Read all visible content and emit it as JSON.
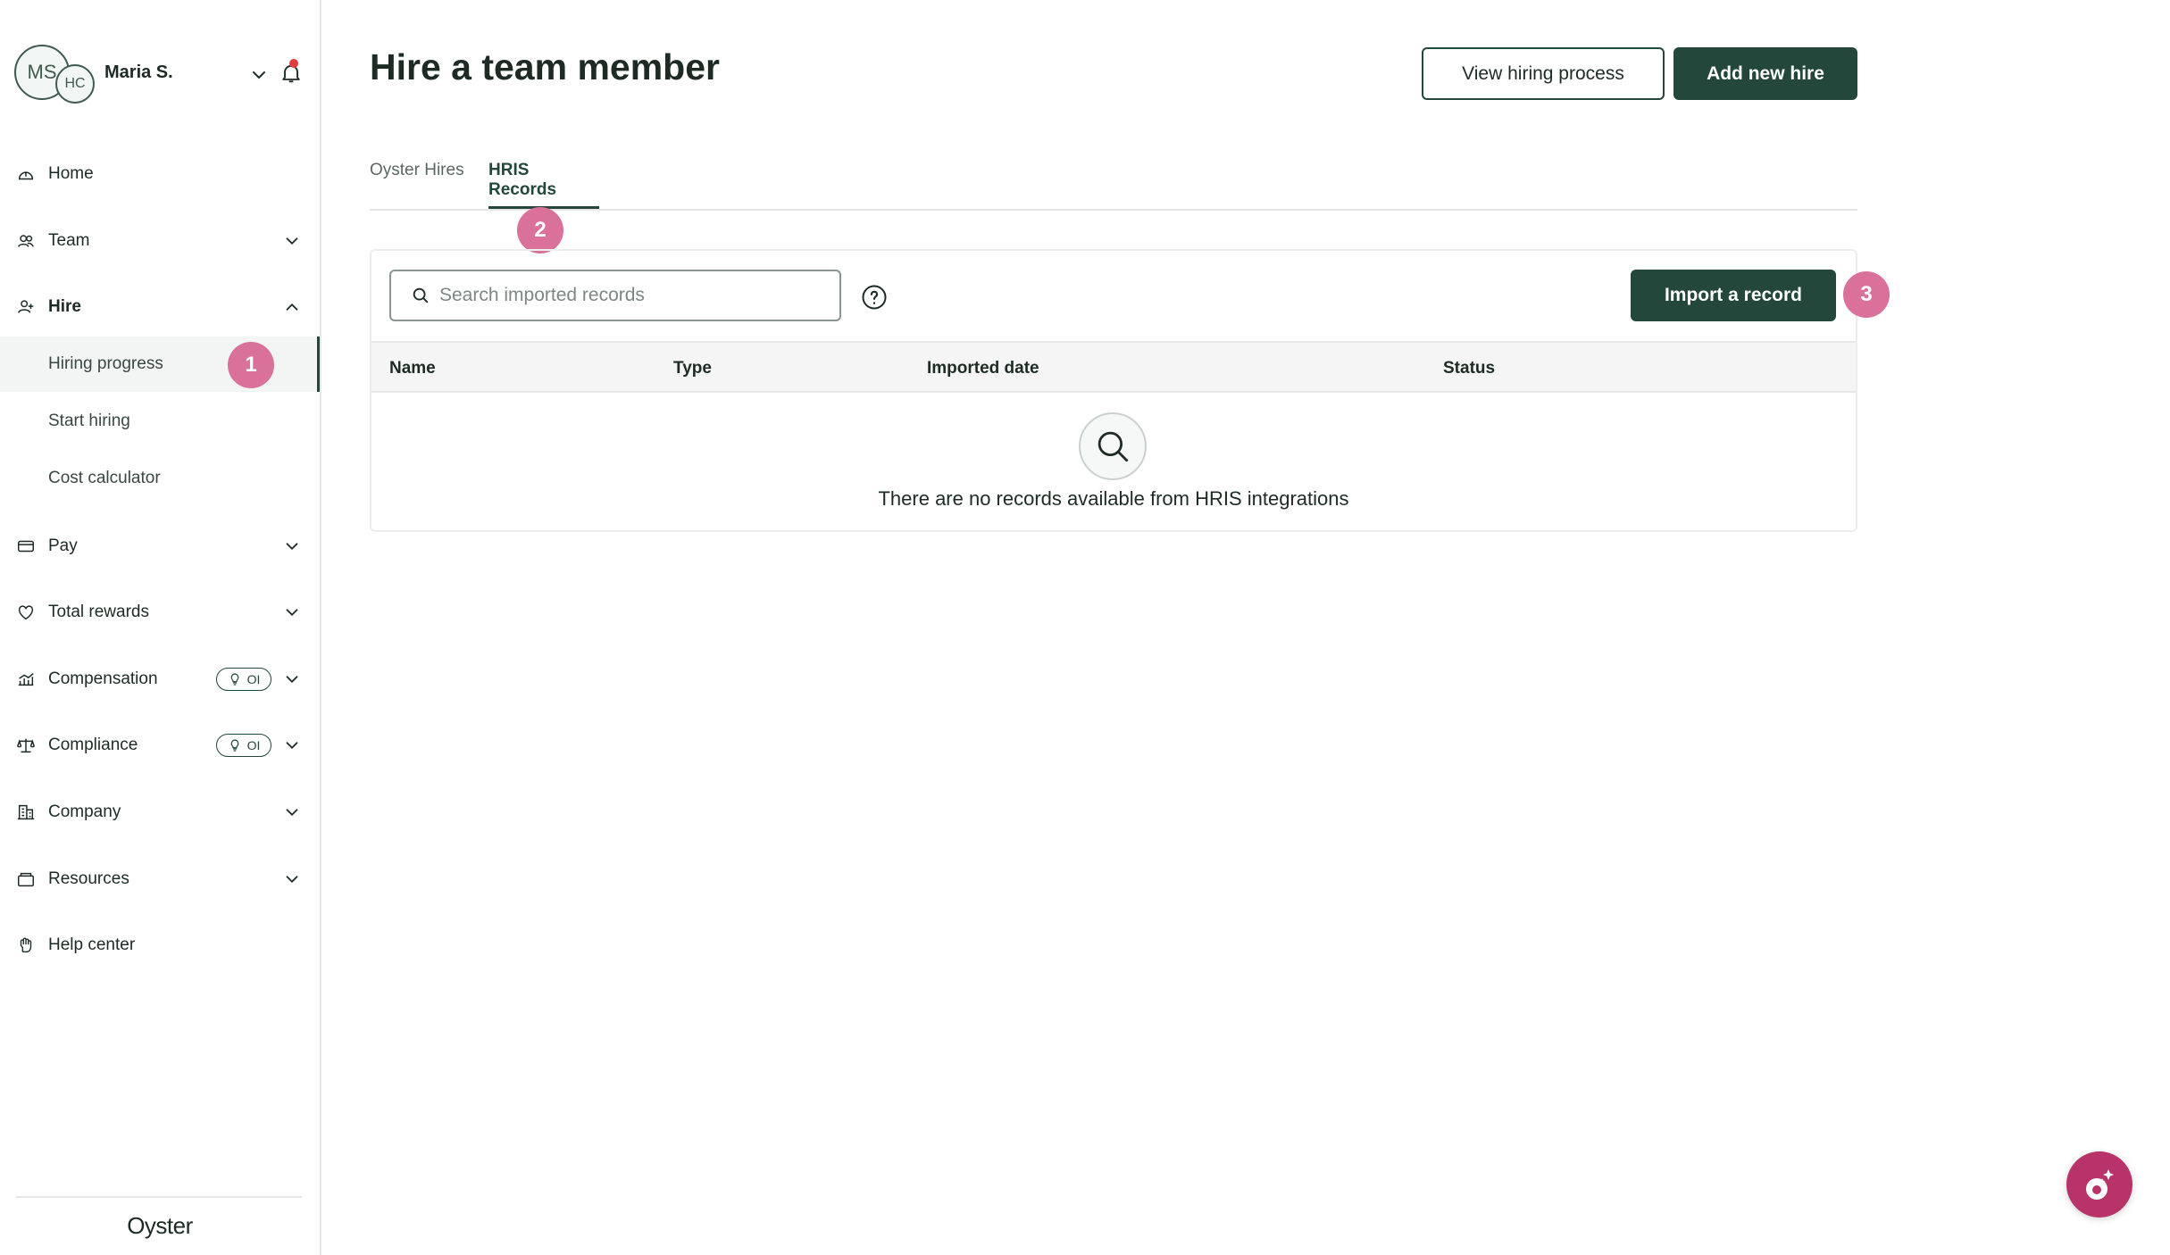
{
  "user": {
    "initials_primary": "MS",
    "initials_secondary": "HC",
    "name": "Maria S."
  },
  "sidebar": {
    "items": [
      {
        "label": "Home"
      },
      {
        "label": "Team"
      },
      {
        "label": "Hire"
      },
      {
        "label": "Pay"
      },
      {
        "label": "Total rewards"
      },
      {
        "label": "Compensation",
        "badge": "OI"
      },
      {
        "label": "Compliance",
        "badge": "OI"
      },
      {
        "label": "Company"
      },
      {
        "label": "Resources"
      },
      {
        "label": "Help center"
      }
    ],
    "hire_subitems": [
      {
        "label": "Hiring progress",
        "active": true
      },
      {
        "label": "Start hiring"
      },
      {
        "label": "Cost calculator"
      }
    ],
    "brand": "Oyster"
  },
  "markers": [
    "1",
    "2",
    "3"
  ],
  "main": {
    "title": "Hire a team member",
    "view_process_label": "View hiring process",
    "add_hire_label": "Add new hire",
    "tabs": [
      {
        "label": "Oyster Hires"
      },
      {
        "label": "HRIS Records",
        "active": true
      }
    ],
    "search": {
      "placeholder": "Search imported records",
      "value": ""
    },
    "import_label": "Import a record",
    "table": {
      "columns": [
        "Name",
        "Type",
        "Imported date",
        "Status"
      ],
      "rows": [],
      "empty_message": "There are no records available from HRIS integrations"
    }
  },
  "colors": {
    "brand_dark": "#23473b",
    "marker": "#d9719a",
    "notification": "#e23b3b",
    "assistant": "#b8336a"
  },
  "icons": [
    "home-icon",
    "team-icon",
    "hire-icon",
    "pay-icon",
    "heart-icon",
    "compensation-icon",
    "compliance-icon",
    "company-icon",
    "resources-icon",
    "help-icon",
    "bell-icon",
    "search-icon",
    "question-icon",
    "assistant-icon"
  ]
}
